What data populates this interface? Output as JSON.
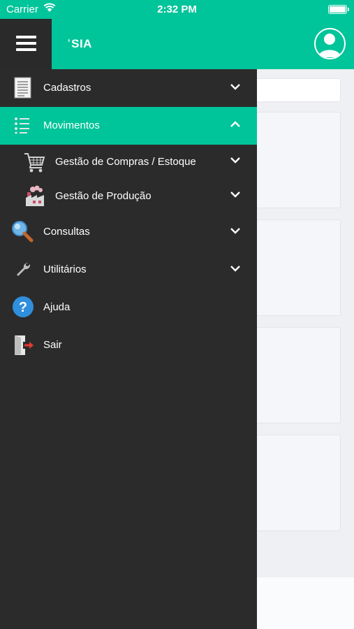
{
  "status_bar": {
    "carrier": "Carrier",
    "time": "2:32 PM"
  },
  "header": {
    "logo": "SIA"
  },
  "menu": {
    "cadastros": {
      "label": "Cadastros",
      "icon": "document-list-icon",
      "expanded": false
    },
    "movimentos": {
      "label": "Movimentos",
      "icon": "list-icon",
      "expanded": true
    },
    "compras": {
      "label": "Gestão de Compras / Estoque",
      "icon": "shopping-cart-icon",
      "expanded": false
    },
    "producao": {
      "label": "Gestão de Produção",
      "icon": "factory-icon",
      "expanded": false
    },
    "consultas": {
      "label": "Consultas",
      "icon": "magnifier-icon",
      "expanded": false
    },
    "utilitarios": {
      "label": "Utilitários",
      "icon": "wrench-icon",
      "expanded": false
    },
    "ajuda": {
      "label": "Ajuda",
      "icon": "help-icon"
    },
    "sair": {
      "label": "Sair",
      "icon": "exit-door-icon"
    }
  },
  "colors": {
    "accent": "#00c49a",
    "drawer": "#2b2b2b",
    "text": "#ffffff"
  }
}
